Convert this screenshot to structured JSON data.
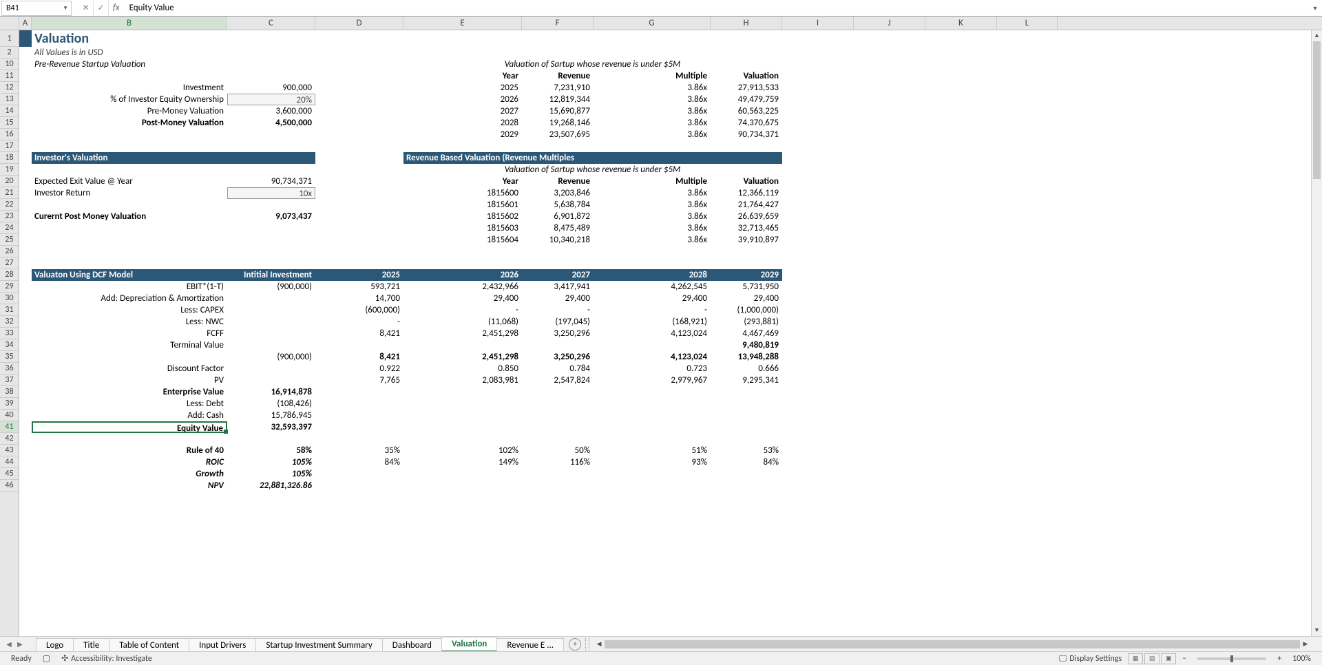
{
  "formula_bar": {
    "name_box": "B41",
    "formula": "Equity Value"
  },
  "columns": [
    "A",
    "B",
    "C",
    "D",
    "E",
    "F",
    "G",
    "H",
    "I",
    "J",
    "K",
    "L"
  ],
  "row_numbers": [
    "1",
    "2",
    "10",
    "11",
    "12",
    "13",
    "14",
    "15",
    "16",
    "17",
    "18",
    "19",
    "20",
    "21",
    "22",
    "23",
    "24",
    "25",
    "26",
    "27",
    "28",
    "29",
    "30",
    "31",
    "32",
    "33",
    "34",
    "35",
    "36",
    "37",
    "38",
    "39",
    "40",
    "41",
    "42",
    "43",
    "44",
    "45",
    "46"
  ],
  "active_row": "41",
  "active_col": "B",
  "title": "Valuation",
  "subtitle": "All Values is in USD",
  "pre_rev_header": "Pre-Revenue Startup Valuation",
  "right_header_1": "Valuation of Sartup whose revenue is under $5M",
  "yr_hdr": {
    "year": "Year",
    "rev": "Revenue",
    "mult": "Multiple",
    "val": "Valuation"
  },
  "inv_label": "Investment",
  "inv_val": "900,000",
  "pct_label": "% of Investor Equity Ownership",
  "pct_val": "20%",
  "pre_label": "Pre-Money Valuation",
  "pre_val": "3,600,000",
  "post_label": "Post-Money Valuation",
  "post_val": "4,500,000",
  "t1": [
    {
      "y": "2025",
      "r": "7,231,910",
      "m": "3.86x",
      "v": "27,913,533"
    },
    {
      "y": "2026",
      "r": "12,819,344",
      "m": "3.86x",
      "v": "49,479,759"
    },
    {
      "y": "2027",
      "r": "15,690,877",
      "m": "3.86x",
      "v": "60,563,225"
    },
    {
      "y": "2028",
      "r": "19,268,146",
      "m": "3.86x",
      "v": "74,370,675"
    },
    {
      "y": "2029",
      "r": "23,507,695",
      "m": "3.86x",
      "v": "90,734,371"
    }
  ],
  "inv_val_hdr": "Investor's Valuation",
  "rev_based_hdr": "Revenue Based Valuation (Revenue Multiples",
  "right_header_2": "Valuation of Sartup whose revenue is under $5M",
  "exp_exit_label": "Expected Exit Value @ Year",
  "exp_exit_val": "90,734,371",
  "inv_ret_label": "Investor Return",
  "inv_ret_val": "10x",
  "cur_post_label": "Curernt Post Money Valuation",
  "cur_post_val": "9,073,437",
  "t2": [
    {
      "y": "1815600",
      "r": "3,203,846",
      "m": "3.86x",
      "v": "12,366,119"
    },
    {
      "y": "1815601",
      "r": "5,638,784",
      "m": "3.86x",
      "v": "21,764,427"
    },
    {
      "y": "1815602",
      "r": "6,901,872",
      "m": "3.86x",
      "v": "26,639,659"
    },
    {
      "y": "1815603",
      "r": "8,475,489",
      "m": "3.86x",
      "v": "32,713,465"
    },
    {
      "y": "1815604",
      "r": "10,340,218",
      "m": "3.86x",
      "v": "39,910,897"
    }
  ],
  "dcf_hdr": "Valuaton Using DCF Model",
  "dcf_init": "Intitial Investment",
  "dcf_years": [
    "2025",
    "2026",
    "2027",
    "2028",
    "2029"
  ],
  "dcf_rows": [
    {
      "l": "EBIT*(1-T)",
      "c": "(900,000)",
      "d": "593,721",
      "e": "2,432,966",
      "f": "3,417,941",
      "g": "4,262,545",
      "h": "5,731,950"
    },
    {
      "l": "Add: Depreciation & Amortization",
      "c": "",
      "d": "14,700",
      "e": "29,400",
      "f": "29,400",
      "g": "29,400",
      "h": "29,400"
    },
    {
      "l": "Less: CAPEX",
      "c": "",
      "d": "(600,000)",
      "e": "-",
      "f": "-",
      "g": "-",
      "h": "(1,000,000)"
    },
    {
      "l": "Less: NWC",
      "c": "",
      "d": "-",
      "e": "(11,068)",
      "f": "(197,045)",
      "g": "(168,921)",
      "h": "(293,881)"
    },
    {
      "l": "FCFF",
      "c": "",
      "d": "8,421",
      "e": "2,451,298",
      "f": "3,250,296",
      "g": "4,123,024",
      "h": "4,467,469"
    },
    {
      "l": "Terminal Value",
      "c": "",
      "d": "",
      "e": "",
      "f": "",
      "g": "",
      "h": "9,480,819"
    }
  ],
  "dcf_sum": {
    "c": "(900,000)",
    "d": "8,421",
    "e": "2,451,298",
    "f": "3,250,296",
    "g": "4,123,024",
    "h": "13,948,288"
  },
  "disc": {
    "l": "Discount Factor",
    "d": "0.922",
    "e": "0.850",
    "f": "0.784",
    "g": "0.723",
    "h": "0.666"
  },
  "pv": {
    "l": "PV",
    "d": "7,765",
    "e": "2,083,981",
    "f": "2,547,824",
    "g": "2,979,967",
    "h": "9,295,341"
  },
  "ev": {
    "l": "Enterprise Value",
    "v": "16,914,878"
  },
  "debt": {
    "l": "Less: Debt",
    "v": "(108,426)"
  },
  "cash": {
    "l": "Add: Cash",
    "v": "15,786,945"
  },
  "eqv": {
    "l": "Equity Value",
    "v": "32,593,397"
  },
  "r40": {
    "l": "Rule of 40",
    "c": "58%",
    "d": "35%",
    "e": "102%",
    "f": "50%",
    "g": "51%",
    "h": "53%"
  },
  "roic": {
    "l": "ROIC",
    "c": "105%",
    "d": "84%",
    "e": "149%",
    "f": "116%",
    "g": "93%",
    "h": "84%"
  },
  "growth": {
    "l": "Growth",
    "c": "105%"
  },
  "npv": {
    "l": "NPV",
    "c": "22,881,326.86"
  },
  "tabs": [
    "Logo",
    "Title",
    "Table of Content",
    "Input Drivers",
    "Startup Investment Summary",
    "Dashboard",
    "Valuation",
    "Revenue E ..."
  ],
  "active_tab": "Valuation",
  "status": {
    "ready": "Ready",
    "acc": "Accessibility: Investigate",
    "disp": "Display Settings",
    "zoom": "100%"
  }
}
